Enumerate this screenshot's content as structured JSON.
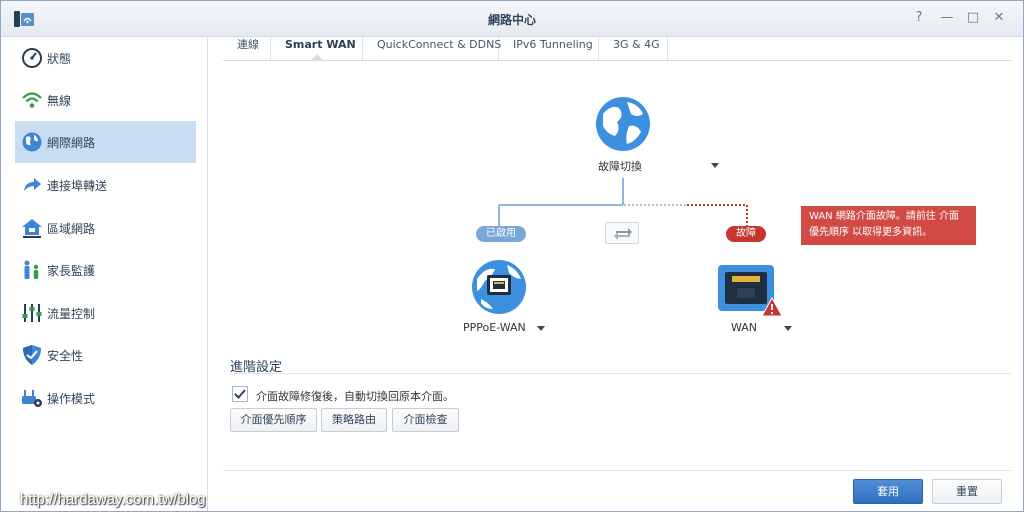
{
  "window": {
    "title": "網路中心"
  },
  "window_controls": {
    "help": "?",
    "minimize": "—",
    "maximize": "□",
    "close": "✕"
  },
  "sidebar": {
    "items": [
      {
        "label": "狀態",
        "icon": "gauge-icon"
      },
      {
        "label": "無線",
        "icon": "wifi-icon"
      },
      {
        "label": "網際網路",
        "icon": "globe-icon",
        "active": true
      },
      {
        "label": "連接埠轉送",
        "icon": "forward-arrow-icon"
      },
      {
        "label": "區域網路",
        "icon": "home-network-icon"
      },
      {
        "label": "家長監護",
        "icon": "family-icon"
      },
      {
        "label": "流量控制",
        "icon": "sliders-icon"
      },
      {
        "label": "安全性",
        "icon": "shield-icon"
      },
      {
        "label": "操作模式",
        "icon": "router-gear-icon"
      }
    ]
  },
  "tabs": [
    {
      "label": "連線"
    },
    {
      "label": "Smart WAN",
      "active": true
    },
    {
      "label": "QuickConnect & DDNS"
    },
    {
      "label": "IPv6 Tunneling"
    },
    {
      "label": "3G & 4G"
    }
  ],
  "diagram": {
    "top_node": {
      "label": "故障切換"
    },
    "left_node": {
      "label": "PPPoE-WAN",
      "status": "已啟用"
    },
    "right_node": {
      "label": "WAN",
      "status": "故障"
    },
    "tooltip": {
      "line1": "WAN 網路介面故障。請前往 介面",
      "line2": "優先順序 以取得更多資訊。"
    }
  },
  "advanced": {
    "title": "進階設定",
    "checkbox_label": "介面故障修復後，自動切換回原本介面。",
    "checked": true,
    "buttons": {
      "priority": "介面優先順序",
      "policy": "策略路由",
      "check": "介面檢查"
    }
  },
  "footer": {
    "apply": "套用",
    "reset": "重置"
  },
  "watermark": "http://hardaway.com.tw/blog",
  "colors": {
    "accent": "#2f6fbd",
    "fault": "#c6362e",
    "enabled": "#79a7da",
    "sidebar_active": "#c6ddf2"
  }
}
